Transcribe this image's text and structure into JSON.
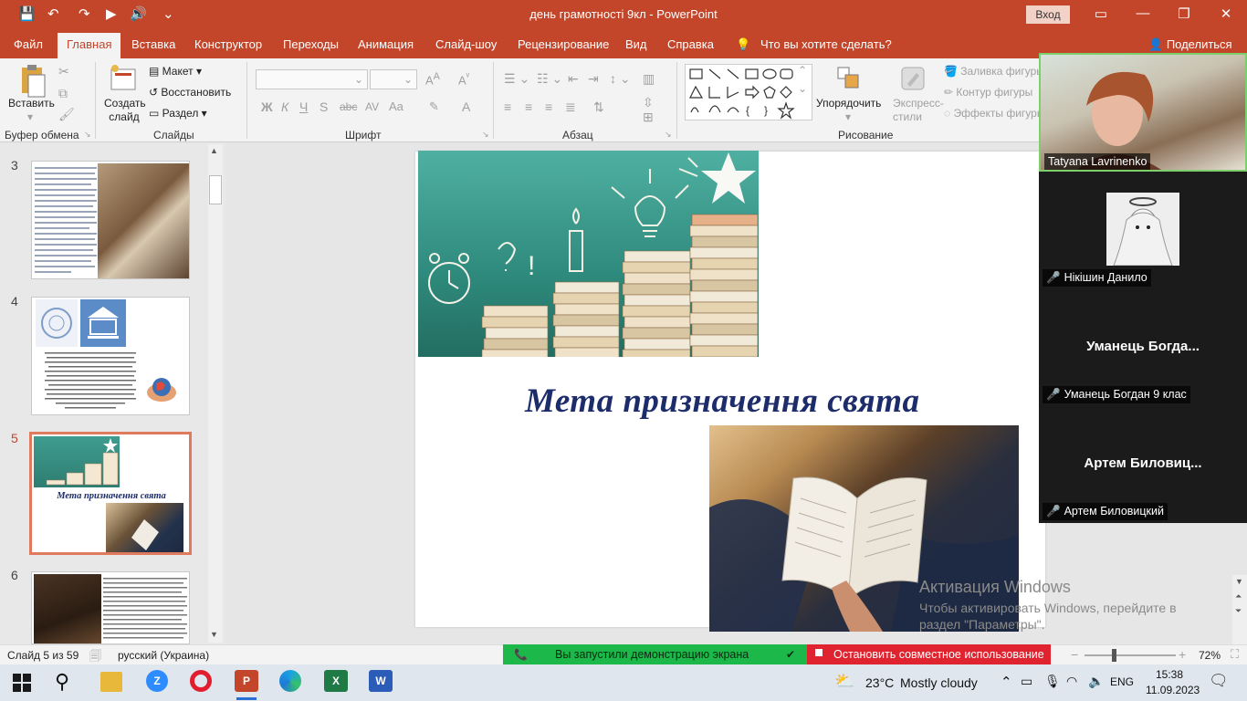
{
  "window": {
    "title": "день грамотності 9кл  -  PowerPoint",
    "signin": "Вход",
    "min": "—",
    "restore": "❐",
    "close": "✕"
  },
  "quick_access": {
    "save": "💾",
    "undo": "↶",
    "redo": "↷",
    "present": "▶",
    "speaker": "🔊",
    "more": "⌄"
  },
  "tabs": [
    "Файл",
    "Главная",
    "Вставка",
    "Конструктор",
    "Переходы",
    "Анимация",
    "Слайд-шоу",
    "Рецензирование",
    "Вид",
    "Справка"
  ],
  "active_tab": "Главная",
  "tell_me": "Что вы хотите сделать?",
  "share": "Поделиться",
  "ribbon": {
    "clipboard": {
      "label": "Буфер обмена",
      "paste": "Вставить"
    },
    "slides": {
      "label": "Слайды",
      "new_slide": "Создать слайд",
      "layout": "Макет",
      "reset": "Восстановить",
      "section": "Раздел"
    },
    "font": {
      "label": "Шрифт",
      "bold": "Ж",
      "italic": "К",
      "underline": "Ч",
      "strike": "S",
      "spacing": "AV",
      "case": "Aa",
      "color": "A"
    },
    "paragraph": {
      "label": "Абзац"
    },
    "drawing": {
      "label": "Рисование",
      "arrange": "Упорядочить",
      "quick_styles": "Экспресс-стили",
      "fill": "Заливка фигуры",
      "outline": "Контур фигуры",
      "effects": "Эффекты фигуры"
    }
  },
  "thumbnails": [
    {
      "num": "3"
    },
    {
      "num": "4"
    },
    {
      "num": "5",
      "title": "Мета призначення  свята"
    },
    {
      "num": "6"
    }
  ],
  "slide": {
    "title": "Мета призначення  свята"
  },
  "watermark": {
    "title": "Активация Windows",
    "line1": "Чтобы активировать Windows, перейдите в",
    "line2": "раздел \"Параметры\"."
  },
  "status": {
    "slide_info": "Слайд 5 из 59",
    "language": "русский (Украина)",
    "zoom": "72%"
  },
  "sharing": {
    "message": "Вы запустили демонстрацию экрана",
    "stop": "Остановить совместное использование",
    "colors": {
      "green": "#1cb84a",
      "red": "#e0242f"
    }
  },
  "participants": [
    {
      "name": "Tatyana Lavrinenko"
    },
    {
      "name": "Нікішин Данило"
    },
    {
      "display": "Уманець  Богда...",
      "name": "Уманець Богдан 9 клас"
    },
    {
      "display": "Артем  Биловиц...",
      "name": "Артем Биловицкий"
    }
  ],
  "taskbar": {
    "weather_temp": "23°C",
    "weather_text": "Mostly cloudy",
    "lang": "ENG",
    "time": "15:38",
    "date": "11.09.2023"
  },
  "colors": {
    "accent": "#c4462a",
    "slide_title": "#1d2d6b"
  }
}
